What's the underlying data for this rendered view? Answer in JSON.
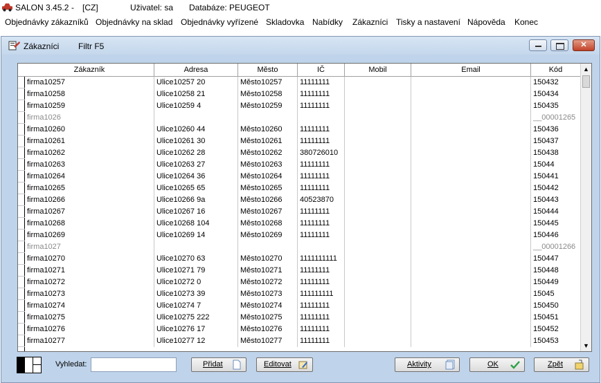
{
  "titlebar": {
    "app": "SALON 3.45.2",
    "sep": "-",
    "lang": "[CZ]",
    "user": "Uživatel: sa",
    "db": "Databáze: PEUGEOT"
  },
  "menu": [
    "Objednávky zákazníků",
    "Objednávky na sklad",
    "Objednávky vyřízené",
    "Skladovka",
    "Nabídky",
    "Zákazníci",
    "Tisky a nastavení",
    "Nápověda",
    "Konec"
  ],
  "window": {
    "title": "Zákazníci",
    "filter": "Filtr F5"
  },
  "columns": [
    "Zákazník",
    "Adresa",
    "Město",
    "IČ",
    "Mobil",
    "Email",
    "Kód"
  ],
  "rows": [
    [
      "firma10257",
      "Ulice10257 20",
      "Město10257",
      "11111111",
      "",
      "",
      "150432"
    ],
    [
      "firma10258",
      "Ulice10258 21",
      "Město10258",
      "11111111",
      "",
      "",
      "150434"
    ],
    [
      "firma10259",
      "Ulice10259 4",
      "Město10259",
      "11111111",
      "",
      "",
      "150435"
    ],
    [
      "firma1026",
      "",
      "",
      "",
      "",
      "",
      "__00001265"
    ],
    [
      "firma10260",
      "Ulice10260 44",
      "Město10260",
      "11111111",
      "",
      "",
      "150436"
    ],
    [
      "firma10261",
      "Ulice10261 30",
      "Město10261",
      "11111111",
      "",
      "",
      "150437"
    ],
    [
      "firma10262",
      "Ulice10262 28",
      "Město10262",
      "380726010",
      "",
      "",
      "150438"
    ],
    [
      "firma10263",
      "Ulice10263 27",
      "Město10263",
      "11111111",
      "",
      "",
      "15044"
    ],
    [
      "firma10264",
      "Ulice10264 36",
      "Město10264",
      "11111111",
      "",
      "",
      "150441"
    ],
    [
      "firma10265",
      "Ulice10265 65",
      "Město10265",
      "11111111",
      "",
      "",
      "150442"
    ],
    [
      "firma10266",
      "Ulice10266 9a",
      "Město10266",
      "40523870",
      "",
      "",
      "150443"
    ],
    [
      "firma10267",
      "Ulice10267 16",
      "Město10267",
      "11111111",
      "",
      "",
      "150444"
    ],
    [
      "firma10268",
      "Ulice10268 104",
      "Město10268",
      "11111111",
      "",
      "",
      "150445"
    ],
    [
      "firma10269",
      "Ulice10269 14",
      "Město10269",
      "11111111",
      "",
      "",
      "150446"
    ],
    [
      "firma1027",
      "",
      "",
      "",
      "",
      "",
      "__00001266"
    ],
    [
      "firma10270",
      "Ulice10270 63",
      "Město10270",
      "1111111111",
      "",
      "",
      "150447"
    ],
    [
      "firma10271",
      "Ulice10271 79",
      "Město10271",
      "11111111",
      "",
      "",
      "150448"
    ],
    [
      "firma10272",
      "Ulice10272 0",
      "Město10272",
      "11111111",
      "",
      "",
      "150449"
    ],
    [
      "firma10273",
      "Ulice10273 39",
      "Město10273",
      "111111111",
      "",
      "",
      "15045"
    ],
    [
      "firma10274",
      "Ulice10274 7",
      "Město10274",
      "11111111",
      "",
      "",
      "150450"
    ],
    [
      "firma10275",
      "Ulice10275 222",
      "Město10275",
      "11111111",
      "",
      "",
      "150451"
    ],
    [
      "firma10276",
      "Ulice10276 17",
      "Město10276",
      "11111111",
      "",
      "",
      "150452"
    ],
    [
      "firma10277",
      "Ulice10277 12",
      "Město10277",
      "11111111",
      "",
      "",
      "150453"
    ]
  ],
  "dim_rows": [
    3,
    14
  ],
  "bottom": {
    "search_label": "Vyhledat:",
    "search_value": "",
    "add": "Přidat",
    "edit": "Editovat",
    "activity": "Aktivity",
    "ok": "OK",
    "back": "Zpět"
  }
}
